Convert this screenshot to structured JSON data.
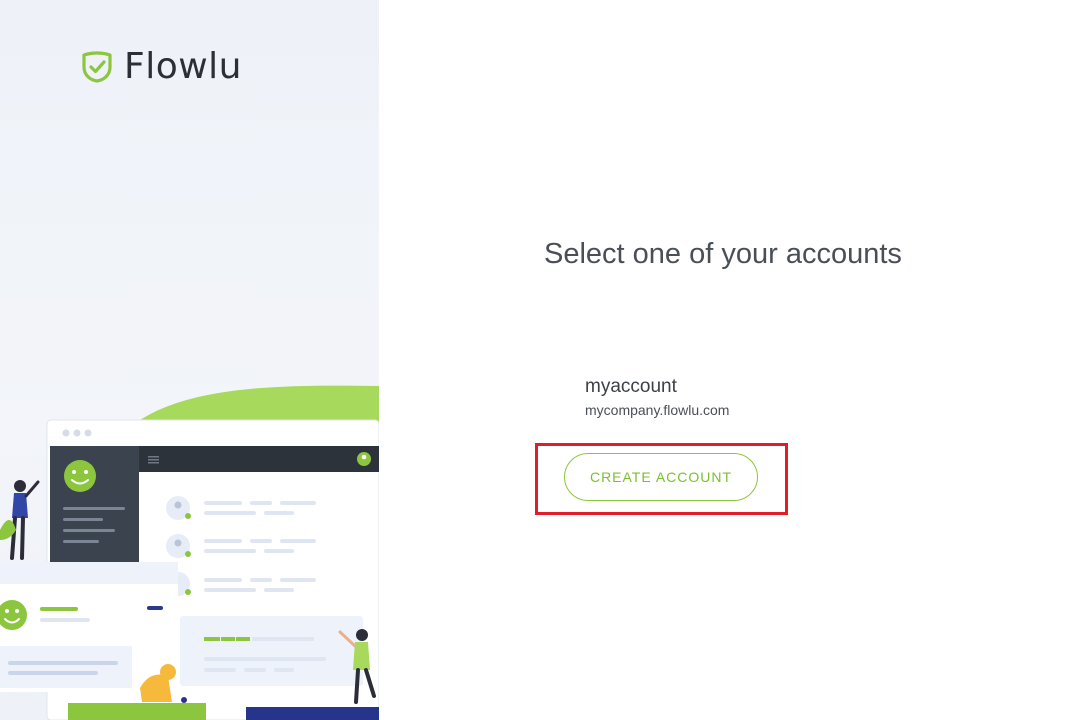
{
  "brand": {
    "name": "Flowlu",
    "accent": "#8cc63f",
    "logo_icon": "shield-check-icon"
  },
  "main": {
    "title": "Select one of your accounts",
    "accounts": [
      {
        "name": "myaccount",
        "domain": "mycompany.flowlu.com"
      }
    ],
    "create_button_label": "CREATE ACCOUNT",
    "highlight_color": "#e11d2b"
  }
}
